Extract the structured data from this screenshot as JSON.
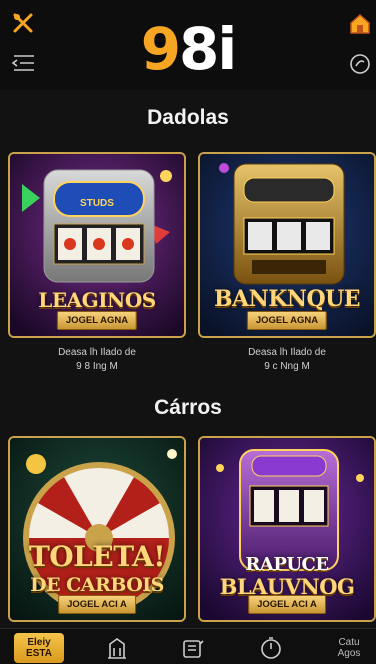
{
  "app": {
    "logo": "98i"
  },
  "header": {
    "icons": [
      "tools-icon",
      "home-icon",
      "menu-icon",
      "support-icon"
    ]
  },
  "sections": [
    {
      "title": "Dadolas",
      "cards": [
        {
          "title": "LEAGINOS",
          "cta": "JOGEL AGNA",
          "desc_line1": "Deasa lh Ilado de",
          "desc_line2": "9 8 Ing M",
          "badge": "STUDS"
        },
        {
          "title": "BANKNQUE",
          "cta": "JOGEL AGNA",
          "desc_line1": "Deasa lh Ilado de",
          "desc_line2": "9 c Nng M"
        }
      ]
    },
    {
      "title": "Cárros",
      "cards": [
        {
          "title_line1": "TOLETA!",
          "title_line2": "DE CARBOIS",
          "cta": "JOGEL ACI A"
        },
        {
          "title_line1": "RAPUCE",
          "title_line2": "BLAUVNOG",
          "cta": "JOGEL ACI A"
        }
      ]
    }
  ],
  "bottom_nav": [
    {
      "label_line1": "Eleiy",
      "label_line2": "ESTA",
      "icon": "home-icon",
      "active": true
    },
    {
      "label": "",
      "icon": "building-icon"
    },
    {
      "label": "",
      "icon": "slot-machine-icon"
    },
    {
      "label": "",
      "icon": "timer-icon"
    },
    {
      "label_line1": "Catu",
      "label_line2": "Agos",
      "icon": ""
    }
  ],
  "colors": {
    "accent": "#f6a623",
    "card_border": "#c9a24a",
    "bg": "#121212"
  }
}
